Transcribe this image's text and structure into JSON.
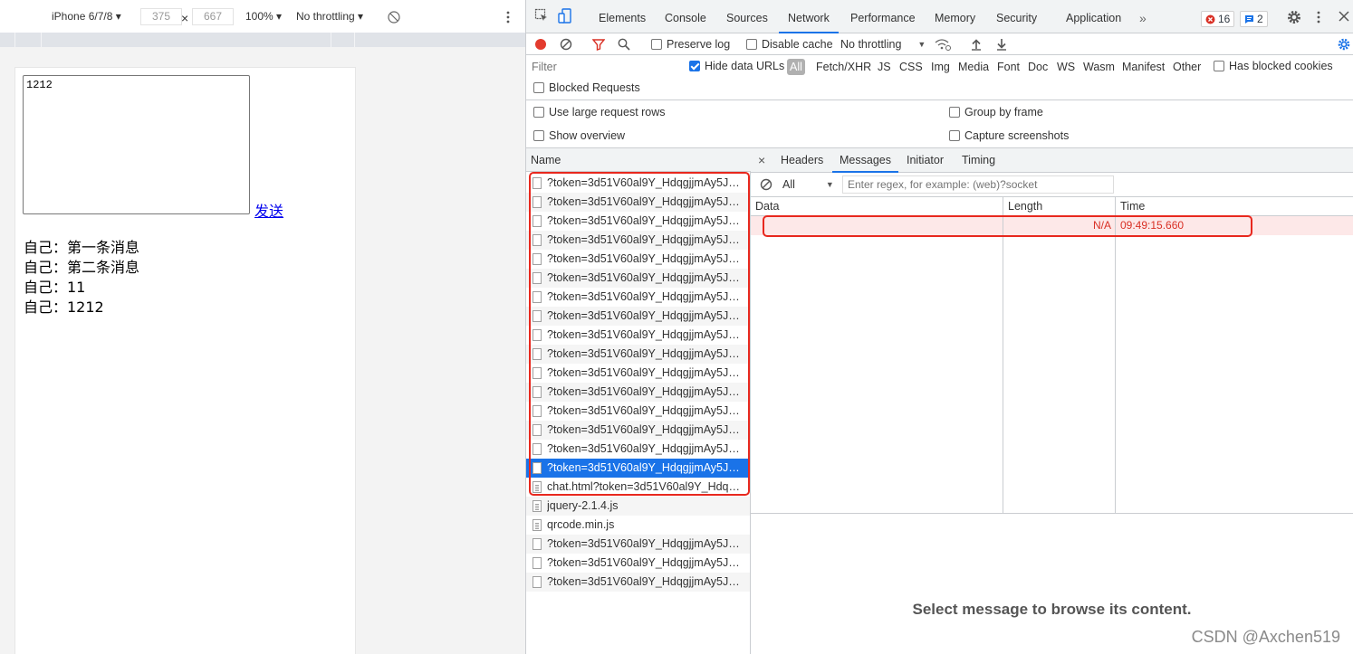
{
  "device_toolbar": {
    "device": "iPhone 6/7/8 ▾",
    "width": "375",
    "times": "×",
    "height": "667",
    "zoom": "100% ▾",
    "throttling": "No throttling ▾"
  },
  "page": {
    "textarea_value": "1212",
    "send_link": "发送",
    "messages": [
      "自己：第一条消息",
      "自己：第二条消息",
      "自己：11",
      "自己：1212"
    ]
  },
  "devtools_tabs": {
    "items": [
      "Elements",
      "Console",
      "Sources",
      "Network",
      "Performance",
      "Memory",
      "Security",
      "Application"
    ],
    "active": "Network",
    "more": "»",
    "errors": "16",
    "messages": "2"
  },
  "network_toolbar": {
    "preserve_log": "Preserve log",
    "disable_cache": "Disable cache",
    "throttling": "No throttling"
  },
  "filter_bar": {
    "filter_placeholder": "Filter",
    "hide_data_urls": "Hide data URLs",
    "types": [
      "All",
      "Fetch/XHR",
      "JS",
      "CSS",
      "Img",
      "Media",
      "Font",
      "Doc",
      "WS",
      "Wasm",
      "Manifest",
      "Other"
    ],
    "has_blocked_cookies": "Has blocked cookies",
    "blocked_requests": "Blocked Requests"
  },
  "settings": {
    "large_rows": "Use large request rows",
    "group_by_frame": "Group by frame",
    "show_overview": "Show overview",
    "capture_screenshots": "Capture screenshots"
  },
  "requests": {
    "header": "Name",
    "rows": [
      "?token=3d51V60al9Y_HdqgjjmAy5Jty...",
      "?token=3d51V60al9Y_HdqgjjmAy5Jty...",
      "?token=3d51V60al9Y_HdqgjjmAy5Jty...",
      "?token=3d51V60al9Y_HdqgjjmAy5Jty...",
      "?token=3d51V60al9Y_HdqgjjmAy5Jty...",
      "?token=3d51V60al9Y_HdqgjjmAy5Jty...",
      "?token=3d51V60al9Y_HdqgjjmAy5Jty...",
      "?token=3d51V60al9Y_HdqgjjmAy5Jty...",
      "?token=3d51V60al9Y_HdqgjjmAy5Jty...",
      "?token=3d51V60al9Y_HdqgjjmAy5Jty...",
      "?token=3d51V60al9Y_HdqgjjmAy5Jty...",
      "?token=3d51V60al9Y_HdqgjjmAy5Jty...",
      "?token=3d51V60al9Y_HdqgjjmAy5Jty...",
      "?token=3d51V60al9Y_HdqgjjmAy5Jty...",
      "?token=3d51V60al9Y_HdqgjjmAy5Jty...",
      "?token=3d51V60al9Y_HdqgjjmAy5Jty...",
      "chat.html?token=3d51V60al9Y_Hdqgj...",
      "jquery-2.1.4.js",
      "qrcode.min.js",
      "?token=3d51V60al9Y_HdqgjjmAy5Jty...",
      "?token=3d51V60al9Y_HdqgjjmAy5Jty...",
      "?token=3d51V60al9Y_HdqgjjmAy5Jty..."
    ]
  },
  "detail": {
    "tabs": [
      "Headers",
      "Messages",
      "Initiator",
      "Timing"
    ],
    "active_tab": "Messages",
    "close": "×",
    "filter_select": "All",
    "regex_placeholder": "Enter regex, for example: (web)?socket",
    "columns": [
      "Data",
      "Length",
      "Time"
    ],
    "message": {
      "data": "",
      "length": "N/A",
      "time": "09:49:15.660"
    },
    "empty_text": "Select message to browse its content."
  },
  "watermark": "CSDN @Axchen519",
  "colors": {
    "accent": "#1a73e8",
    "highlight_red": "#e8281e",
    "error_row": "#fde8e8"
  }
}
